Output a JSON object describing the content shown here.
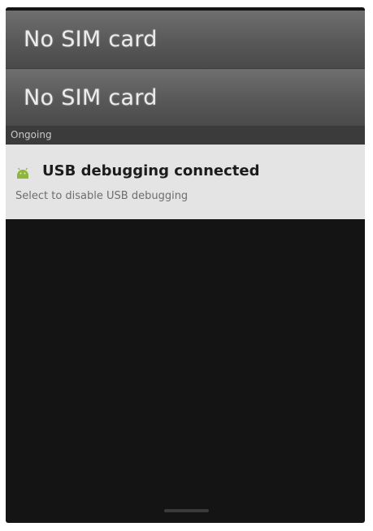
{
  "notifications_panel": {
    "sim_rows": [
      {
        "label": "No SIM card"
      },
      {
        "label": "No SIM card"
      }
    ],
    "ongoing_header": "Ongoing",
    "usb_notification": {
      "icon": "android-icon",
      "title": "USB debugging connected",
      "subtitle": "Select to disable USB debugging"
    }
  },
  "colors": {
    "panel_background": "#141414",
    "sim_row_background": "#5a5a5a",
    "notification_background": "#e4e4e4",
    "android_green": "#8fb53a"
  }
}
